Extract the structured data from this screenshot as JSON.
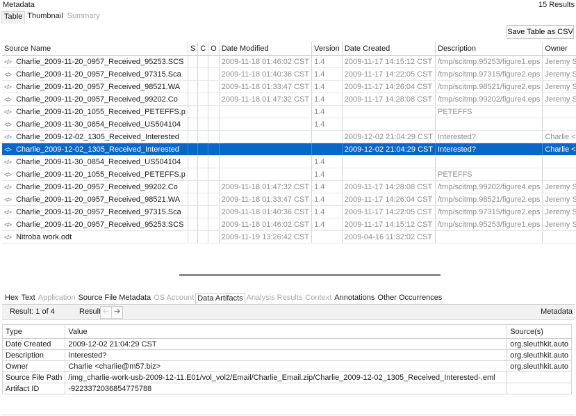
{
  "header": {
    "title": "Metadata",
    "results": "15  Results"
  },
  "top_tabs": [
    {
      "label": "Table",
      "state": "active"
    },
    {
      "label": "Thumbnail",
      "state": "normal"
    },
    {
      "label": "Summary",
      "state": "disabled"
    }
  ],
  "toolbar": {
    "save_label": "Save Table as CSV"
  },
  "grid": {
    "columns": [
      "Source Name",
      "S",
      "C",
      "O",
      "Date Modified",
      "Version",
      "Date Created",
      "Description",
      "Owner"
    ],
    "rows": [
      [
        "Charlie_2009-11-20_0957_Received_95253.SCS",
        "",
        "",
        "",
        "2009-11-18 01:46:02 CST",
        "1.4",
        "2009-11-17 14:15:12 CST",
        "/tmp/scitmp.95253/figure1.eps",
        "Jeremy Str"
      ],
      [
        "Charlie_2009-11-20_0957_Received_97315.Sca",
        "",
        "",
        "",
        "2009-11-18 01:40:36 CST",
        "1.4",
        "2009-11-17 14:22:05 CST",
        "/tmp/scitmp.97315/figure2.eps",
        "Jeremy Str"
      ],
      [
        "Charlie_2009-11-20_0957_Received_98521.WA",
        "",
        "",
        "",
        "2009-11-18 01:33:47 CST",
        "1.4",
        "2009-11-17 14:26:04 CST",
        "/tmp/scitmp.98521/figure2.eps",
        "Jeremy Str"
      ],
      [
        "Charlie_2009-11-20_0957_Received_99202.Co",
        "",
        "",
        "",
        "2009-11-18 01:47:32 CST",
        "1.4",
        "2009-11-17 14:28:08 CST",
        "/tmp/scitmp.99202/figure4.eps",
        "Jeremy Str"
      ],
      [
        "Charlie_2009-11-20_1055_Received_PETEFFS.p",
        "",
        "",
        "",
        "",
        "1.4",
        "",
        "PETEFFS",
        ""
      ],
      [
        "Charlie_2009-11-30_0854_Received_US504104",
        "",
        "",
        "",
        "",
        "1.4",
        "",
        "",
        ""
      ],
      [
        "Charlie_2009-12-02_1305_Received_Interested",
        "",
        "",
        "",
        "",
        "",
        "2009-12-02 21:04:29 CST",
        "Interested?",
        "Charlie <c"
      ],
      [
        "Charlie_2009-12-02_1305_Received_Interested",
        "",
        "",
        "",
        "",
        "",
        "2009-12-02 21:04:29 CST",
        "Interested?",
        "Charlie <c"
      ],
      [
        "Charlie_2009-11-30_0854_Received_US504104",
        "",
        "",
        "",
        "",
        "1.4",
        "",
        "",
        ""
      ],
      [
        "Charlie_2009-11-20_1055_Received_PETEFFS.p",
        "",
        "",
        "",
        "",
        "1.4",
        "",
        "PETEFFS",
        ""
      ],
      [
        "Charlie_2009-11-20_0957_Received_99202.Co",
        "",
        "",
        "",
        "2009-11-18 01:47:32 CST",
        "1.4",
        "2009-11-17 14:28:08 CST",
        "/tmp/scitmp.99202/figure4.eps",
        "Jeremy Str"
      ],
      [
        "Charlie_2009-11-20_0957_Received_98521.WA",
        "",
        "",
        "",
        "2009-11-18 01:33:47 CST",
        "1.4",
        "2009-11-17 14:26:04 CST",
        "/tmp/scitmp.98521/figure2.eps",
        "Jeremy Str"
      ],
      [
        "Charlie_2009-11-20_0957_Received_97315.Sca",
        "",
        "",
        "",
        "2009-11-18 01:40:36 CST",
        "1.4",
        "2009-11-17 14:22:05 CST",
        "/tmp/scitmp.97315/figure2.eps",
        "Jeremy Str"
      ],
      [
        "Charlie_2009-11-20_0957_Received_95253.SCS",
        "",
        "",
        "",
        "2009-11-18 01:46:02 CST",
        "1.4",
        "2009-11-17 14:15:12 CST",
        "/tmp/scitmp.95253/figure1.eps",
        "Jeremy Str"
      ],
      [
        "Nitroba work.odt",
        "",
        "",
        "",
        "2009-11-19 13:26:42 CST",
        "",
        "2009-04-16 11:32:02 CST",
        "",
        ""
      ]
    ],
    "selected_row": 7,
    "row_icon": "file-code-icon"
  },
  "bottom_tabs": [
    {
      "label": "Hex",
      "state": "normal"
    },
    {
      "label": "Text",
      "state": "normal"
    },
    {
      "label": "Application",
      "state": "disabled"
    },
    {
      "label": "Source File Metadata",
      "state": "normal"
    },
    {
      "label": "OS Account",
      "state": "disabled"
    },
    {
      "label": "Data Artifacts",
      "state": "active"
    },
    {
      "label": "Analysis Results",
      "state": "disabled"
    },
    {
      "label": "Context",
      "state": "disabled"
    },
    {
      "label": "Annotations",
      "state": "normal"
    },
    {
      "label": "Other Occurrences",
      "state": "normal"
    }
  ],
  "result_bar": {
    "result_text": "Result:  1   of   4",
    "result_label": "Result",
    "prev_icon": "arrow-left-icon",
    "next_icon": "arrow-right-icon",
    "right_label": "Metadata"
  },
  "artifacts": {
    "columns": [
      "Type",
      "Value",
      "Source(s)"
    ],
    "rows": [
      [
        "Date Created",
        "2009-12-02 21:04:29 CST",
        "org.sleuthkit.auto"
      ],
      [
        "Description",
        "Interested?",
        "org.sleuthkit.auto"
      ],
      [
        "Owner",
        "Charlie <charlie@m57.biz>",
        "org.sleuthkit.auto"
      ],
      [
        "Source File Path",
        "/img_charlie-work-usb-2009-12-11.E01/vol_vol2/Email/Charlie_Email.zip/Charlie_2009-12-02_1305_Received_Interested-.eml",
        ""
      ],
      [
        "Artifact ID",
        "-9223372036854775788",
        ""
      ]
    ]
  },
  "colors": {
    "selection": "#0a67c9",
    "disabled_text": "#a9a9a9"
  }
}
